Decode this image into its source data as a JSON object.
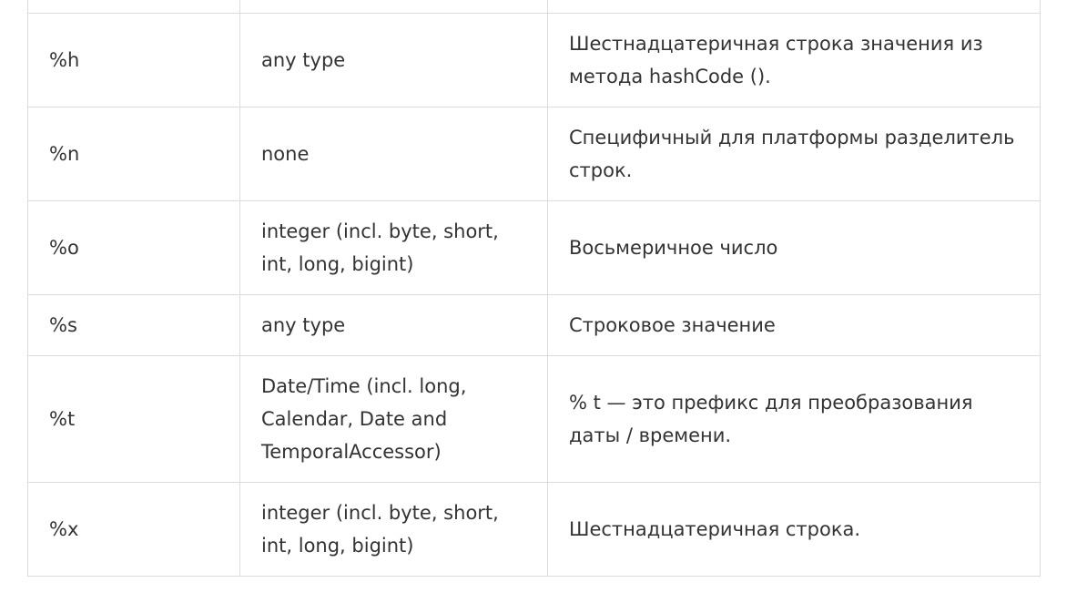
{
  "rows": [
    {
      "specifier": "%h",
      "type": "any type",
      "description": "Шестнадцатеричная строка значения из метода hashCode ()."
    },
    {
      "specifier": "%n",
      "type": "none",
      "description": "Специфичный для платформы разделитель строк."
    },
    {
      "specifier": "%o",
      "type": "integer (incl. byte, short, int, long, bigint)",
      "description": "Восьмеричное число"
    },
    {
      "specifier": "%s",
      "type": "any type",
      "description": "Строковое значение"
    },
    {
      "specifier": "%t",
      "type": "Date/Time (incl. long, Calendar, Date and TemporalAccessor)",
      "description": "% t — это префикс для преобразования даты / времени."
    },
    {
      "specifier": "%x",
      "type": "integer (incl. byte, short, int, long, bigint)",
      "description": "Шестнадцатеричная строка."
    }
  ]
}
